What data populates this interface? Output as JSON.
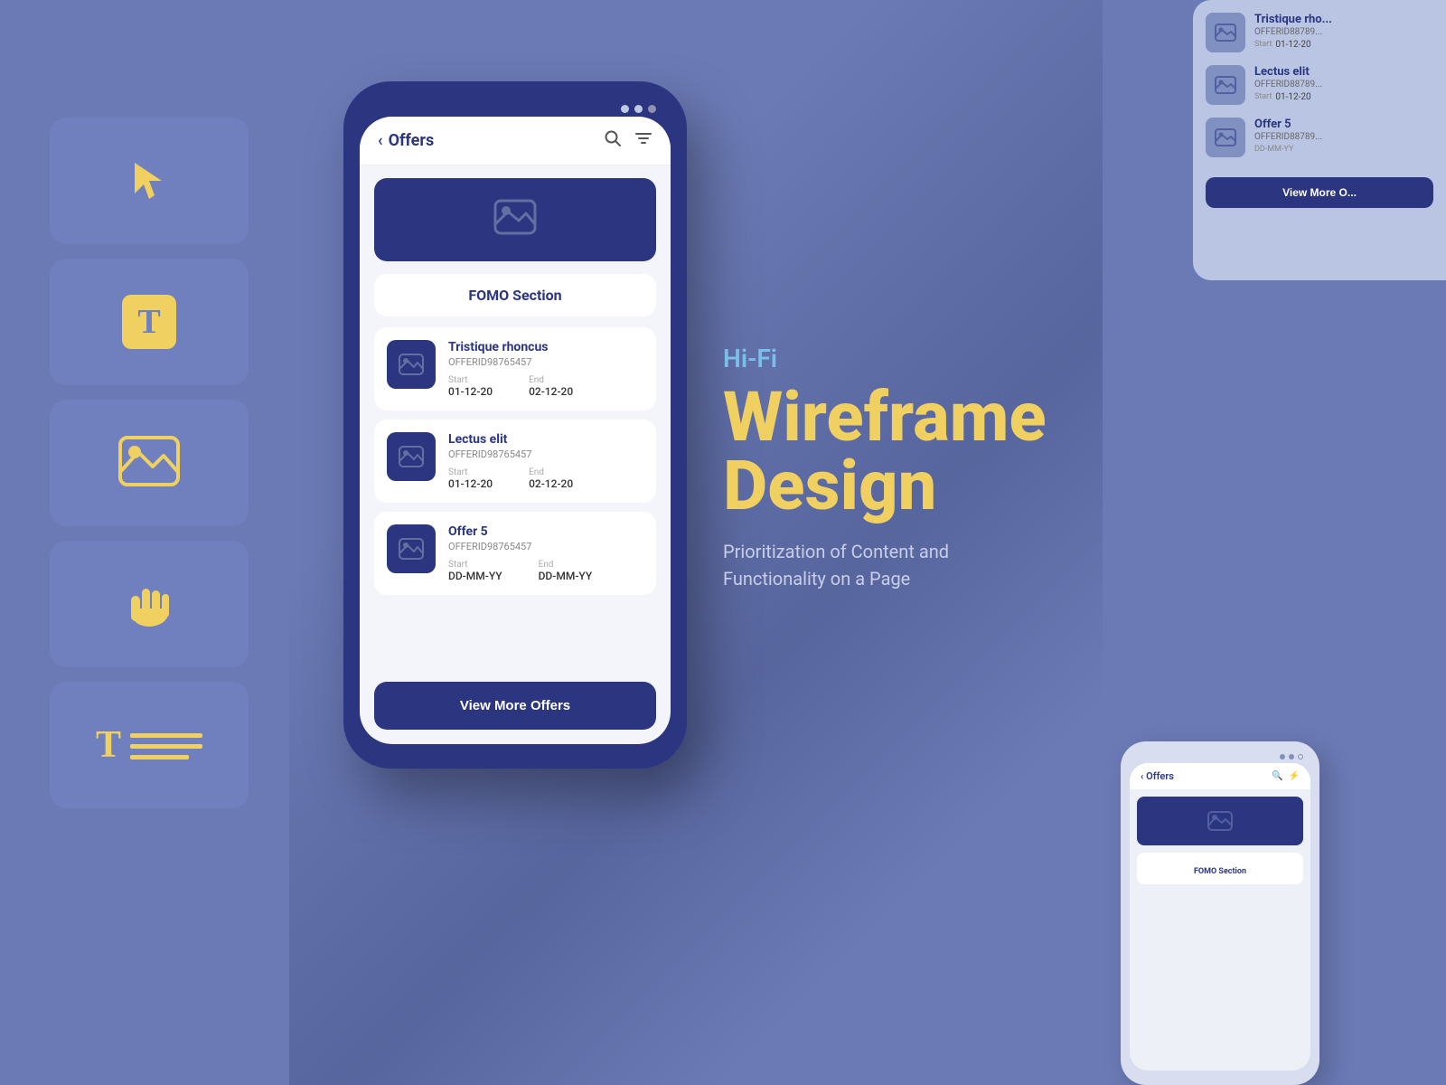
{
  "background": {
    "color": "#6b7ab5"
  },
  "toolbar": {
    "items": [
      {
        "id": "cursor",
        "type": "cursor",
        "label": "Cursor Tool"
      },
      {
        "id": "text",
        "type": "text",
        "label": "Text Tool"
      },
      {
        "id": "image",
        "type": "image",
        "label": "Image Tool"
      },
      {
        "id": "hand",
        "type": "hand",
        "label": "Hand Tool"
      },
      {
        "id": "textpara",
        "type": "textpara",
        "label": "Text Paragraph Tool"
      }
    ]
  },
  "phone_main": {
    "status_dots": [
      "filled",
      "filled",
      "outline"
    ],
    "header": {
      "back_label": "‹",
      "title": "Offers",
      "search_icon": "search",
      "filter_icon": "filter"
    },
    "fomo_section_label": "FOMO Section",
    "offers": [
      {
        "name": "Tristique rhoncus",
        "id": "OFFERID98765457",
        "start_label": "Start",
        "start": "01-12-20",
        "end_label": "End",
        "end": "02-12-20"
      },
      {
        "name": "Lectus elit",
        "id": "OFFERID98765457",
        "start_label": "Start",
        "start": "01-12-20",
        "end_label": "End",
        "end": "02-12-20"
      },
      {
        "name": "Offer 5",
        "id": "OFFERID98765457",
        "start_label": "Start",
        "start": "DD-MM-YY",
        "end_label": "End",
        "end": "DD-MM-YY"
      }
    ],
    "view_more_label": "View More Offers"
  },
  "right_text": {
    "hifi": "Hi-Fi",
    "title_line1": "Wireframe",
    "title_line2": "Design",
    "subtitle": "Prioritization of Content and Functionality on a Page"
  },
  "right_panel": {
    "offers": [
      {
        "name": "Tristique rho...",
        "id": "OFFERID88789...",
        "date_label": "Start",
        "date": "01-12-20"
      },
      {
        "name": "Lectus elit",
        "id": "OFFERID88789...",
        "date_label": "Start",
        "date": "01-12-20"
      },
      {
        "name": "Offer 5",
        "id": "OFFERID88789...",
        "date_label": "DD-MM-YY",
        "date": ""
      }
    ],
    "view_more_label": "View More O..."
  },
  "small_phone": {
    "header": {
      "back_label": "‹ Offers"
    },
    "fomo_label": "FOMO Section"
  }
}
